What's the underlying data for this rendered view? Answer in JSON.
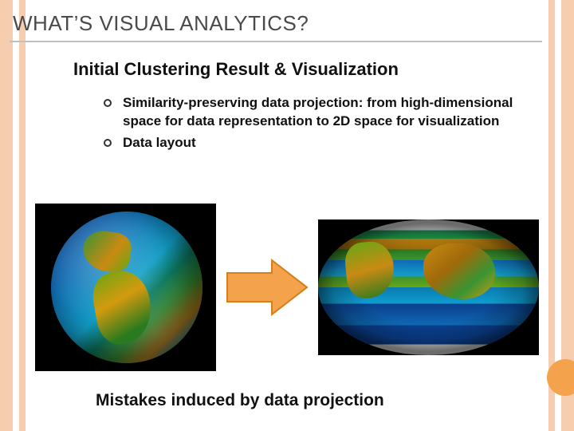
{
  "title": "WHAT’S VISUAL ANALYTICS?",
  "subtitle": "Initial Clustering Result & Visualization",
  "bullets": [
    "Similarity-preserving data projection: from high-dimensional space for data representation to 2D space for visualization",
    "Data layout"
  ],
  "caption": "Mistakes induced by data projection",
  "figures": {
    "left": "globe-western-hemisphere",
    "right": "world-map-projection",
    "arrow": "right-arrow"
  }
}
